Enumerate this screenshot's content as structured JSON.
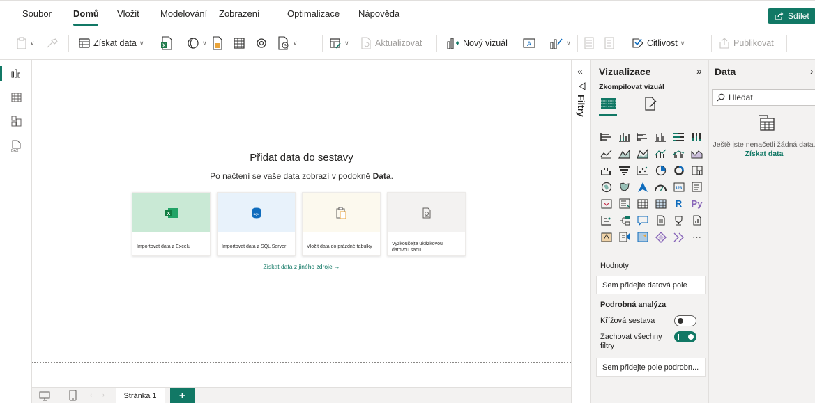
{
  "menu": {
    "tabs": [
      "Soubor",
      "Domů",
      "Vložit",
      "Modelování",
      "Zobrazení",
      "Optimalizace",
      "Nápověda"
    ],
    "share": "Sdílet"
  },
  "ribbon": {
    "get_data": "Získat data",
    "refresh": "Aktualizovat",
    "new_visual": "Nový vizuál",
    "sensitivity": "Citlivost",
    "publish": "Publikovat"
  },
  "canvas": {
    "title": "Přidat data do sestavy",
    "subtitle_prefix": "Po načtení se vaše data zobrazí v podokně",
    "subtitle_bold": "Data",
    "subtitle_suffix": ".",
    "cards": [
      {
        "label": "Importovat data z Excelu",
        "icon": "excel-icon"
      },
      {
        "label": "Importovat data z SQL Server",
        "icon": "sql-icon"
      },
      {
        "label": "Vložit data do prázdné tabulky",
        "icon": "paste-icon"
      },
      {
        "label": "Vyzkoušejte ukázkovou datovou sadu",
        "icon": "sample-dataset-icon"
      }
    ],
    "other_source": "Získat data z jiného zdroje →"
  },
  "bottom": {
    "page_tab": "Stránka 1",
    "add_page": "+"
  },
  "filters": {
    "label": "Filtry"
  },
  "visualizations": {
    "title": "Vizualizace",
    "build_visual": "Zkompilovat vizuál",
    "values_label": "Hodnoty",
    "values_placeholder": "Sem přidejte datová pole",
    "drill_label": "Podrobná analýza",
    "cross_report": "Křížová sestava",
    "keep_filters": "Zachovat všechny filtry",
    "drill_placeholder": "Sem přidejte pole podrobn...",
    "more": "···",
    "r_label": "R",
    "py_label": "Py"
  },
  "data_pane": {
    "title": "Data",
    "search_placeholder": "Hledat",
    "empty_text": "Ještě jste nenačetli žádná data.",
    "empty_link": "Získat data"
  },
  "colors": {
    "accent": "#117865",
    "excel": "#1f7a4a",
    "sql": "#0f6cbd"
  }
}
